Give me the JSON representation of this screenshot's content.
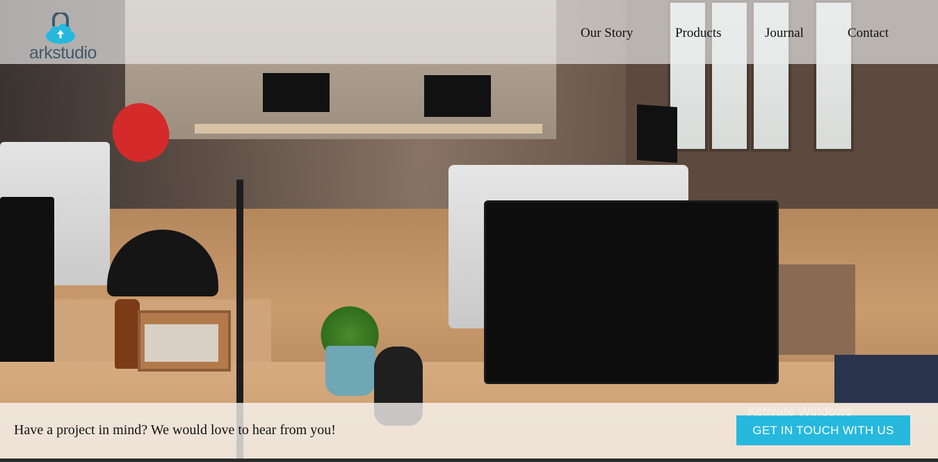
{
  "brand": {
    "name": "arkstudio",
    "logo_icon": "cloud-upload-icon",
    "accent": "#27b8de"
  },
  "nav": {
    "items": [
      {
        "label": "Our Story"
      },
      {
        "label": "Products"
      },
      {
        "label": "Journal"
      },
      {
        "label": "Contact"
      }
    ]
  },
  "cta": {
    "text": "Have a project in mind? We would love to hear from you!",
    "button_label": "GET IN TOUCH WITH US",
    "button_color": "#27b8de"
  },
  "overlay": {
    "activate_text": "Activate Windows"
  }
}
